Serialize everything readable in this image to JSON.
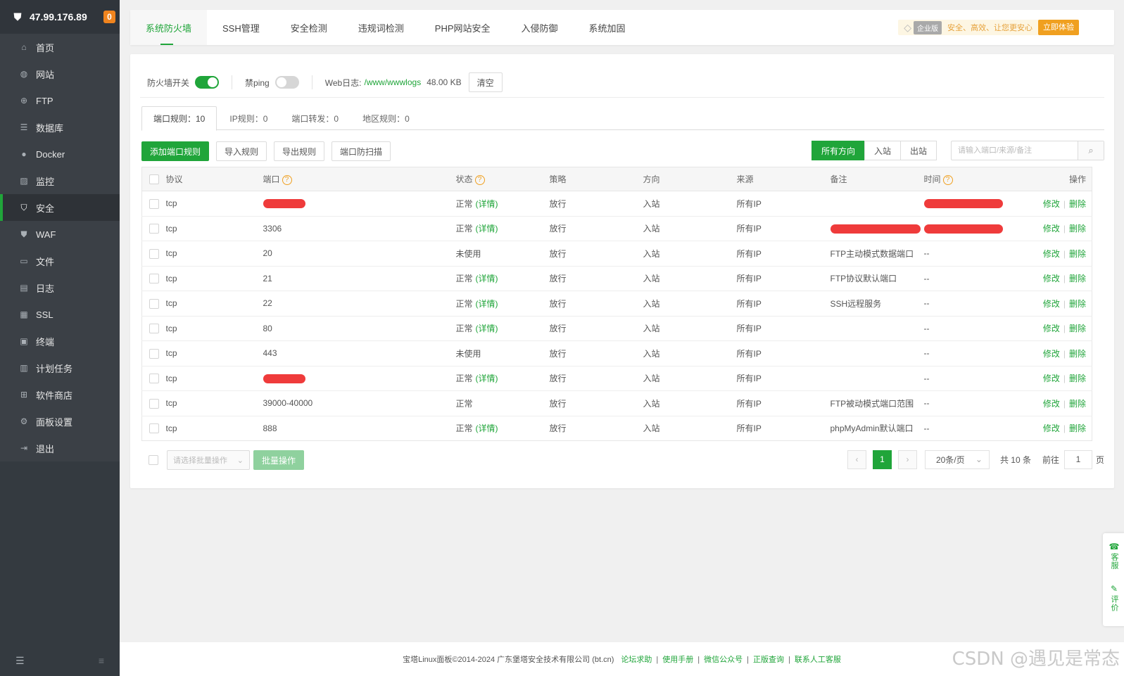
{
  "sidebar": {
    "ip": "47.99.176.89",
    "badge": "0",
    "items": [
      {
        "label": "首页",
        "icon": "home-icon",
        "glyph": "⌂"
      },
      {
        "label": "网站",
        "icon": "globe-icon",
        "glyph": "◍"
      },
      {
        "label": "FTP",
        "icon": "ftp-icon",
        "glyph": "⊕"
      },
      {
        "label": "数据库",
        "icon": "database-icon",
        "glyph": "☰"
      },
      {
        "label": "Docker",
        "icon": "docker-icon",
        "glyph": "●"
      },
      {
        "label": "监控",
        "icon": "monitor-icon",
        "glyph": "▨"
      },
      {
        "label": "安全",
        "icon": "shield-icon",
        "glyph": "⛉"
      },
      {
        "label": "WAF",
        "icon": "waf-icon",
        "glyph": "⛊"
      },
      {
        "label": "文件",
        "icon": "folder-icon",
        "glyph": "▭"
      },
      {
        "label": "日志",
        "icon": "log-icon",
        "glyph": "▤"
      },
      {
        "label": "SSL",
        "icon": "ssl-icon",
        "glyph": "▦"
      },
      {
        "label": "终端",
        "icon": "terminal-icon",
        "glyph": "▣"
      },
      {
        "label": "计划任务",
        "icon": "calendar-icon",
        "glyph": "▥"
      },
      {
        "label": "软件商店",
        "icon": "apps-icon",
        "glyph": "⊞"
      },
      {
        "label": "面板设置",
        "icon": "gear-icon",
        "glyph": "⚙"
      },
      {
        "label": "退出",
        "icon": "logout-icon",
        "glyph": "⇥"
      }
    ],
    "active_index": 6
  },
  "topbar": {
    "tabs": [
      "系统防火墙",
      "SSH管理",
      "安全检测",
      "违规词检测",
      "PHP网站安全",
      "入侵防御",
      "系统加固"
    ],
    "active_index": 0,
    "ent_tag": "企业版",
    "ent_slogan": "安全、高效、让您更安心",
    "ent_button": "立即体验"
  },
  "status": {
    "firewall_label": "防火墙开关",
    "firewall_on": true,
    "ping_label": "禁ping",
    "ping_on": false,
    "weblog_label": "Web日志:",
    "weblog_path": "/www/wwwlogs",
    "weblog_size": "48.00 KB",
    "clear_label": "清空"
  },
  "rule_tabs": [
    "端口规则：10",
    "IP规则：0",
    "端口转发：0",
    "地区规则：0"
  ],
  "toolbar": {
    "add_label": "添加端口规则",
    "import_label": "导入规则",
    "export_label": "导出规则",
    "scan_label": "端口防扫描",
    "directions": [
      "所有方向",
      "入站",
      "出站"
    ],
    "search_placeholder": "请输入端口/来源/备注"
  },
  "table": {
    "headers": {
      "protocol": "协议",
      "port": "端口",
      "status": "状态",
      "policy": "策略",
      "direction": "方向",
      "source": "来源",
      "remark": "备注",
      "time": "时间",
      "ops": "操作"
    },
    "edit_label": "修改",
    "delete_label": "删除",
    "detail_label": "(详情)",
    "rows": [
      {
        "protocol": "tcp",
        "port": "",
        "port_redacted": true,
        "status": "正常",
        "detail": true,
        "policy": "放行",
        "direction": "入站",
        "source": "所有IP",
        "remark": "",
        "time": "",
        "time_redacted": true
      },
      {
        "protocol": "tcp",
        "port": "3306",
        "status": "正常",
        "detail": true,
        "policy": "放行",
        "direction": "入站",
        "source": "所有IP",
        "remark": "",
        "remark_redacted": true,
        "time": ""
      },
      {
        "protocol": "tcp",
        "port": "20",
        "status": "未使用",
        "detail": false,
        "policy": "放行",
        "direction": "入站",
        "source": "所有IP",
        "remark": "FTP主动模式数据端口",
        "time": "--"
      },
      {
        "protocol": "tcp",
        "port": "21",
        "status": "正常",
        "detail": true,
        "policy": "放行",
        "direction": "入站",
        "source": "所有IP",
        "remark": "FTP协议默认端口",
        "time": "--"
      },
      {
        "protocol": "tcp",
        "port": "22",
        "status": "正常",
        "detail": true,
        "policy": "放行",
        "direction": "入站",
        "source": "所有IP",
        "remark": "SSH远程服务",
        "time": "--"
      },
      {
        "protocol": "tcp",
        "port": "80",
        "status": "正常",
        "detail": true,
        "policy": "放行",
        "direction": "入站",
        "source": "所有IP",
        "remark": "",
        "time": "--"
      },
      {
        "protocol": "tcp",
        "port": "443",
        "status": "未使用",
        "detail": false,
        "policy": "放行",
        "direction": "入站",
        "source": "所有IP",
        "remark": "",
        "time": "--"
      },
      {
        "protocol": "tcp",
        "port": "",
        "port_redacted": true,
        "status": "正常",
        "detail": true,
        "policy": "放行",
        "direction": "入站",
        "source": "所有IP",
        "remark": "",
        "time": "--"
      },
      {
        "protocol": "tcp",
        "port": "39000-40000",
        "status": "正常",
        "detail": false,
        "policy": "放行",
        "direction": "入站",
        "source": "所有IP",
        "remark": "FTP被动模式端口范围",
        "time": "--"
      },
      {
        "protocol": "tcp",
        "port": "888",
        "status": "正常",
        "detail": true,
        "policy": "放行",
        "direction": "入站",
        "source": "所有IP",
        "remark": "phpMyAdmin默认端口",
        "time": "--"
      }
    ]
  },
  "pager": {
    "batch_placeholder": "请选择批量操作",
    "batch_button": "批量操作",
    "current_page": "1",
    "page_size": "20条/页",
    "total": "共 10 条",
    "goto_label": "前往",
    "goto_value": "1",
    "page_unit": "页"
  },
  "footer": {
    "copyright": "宝塔Linux面板©2014-2024 广东堡塔安全技术有限公司 (bt.cn)",
    "links": [
      "论坛求助",
      "使用手册",
      "微信公众号",
      "正版查询",
      "联系人工客服"
    ]
  },
  "float": {
    "service": "客服",
    "feedback": "评价"
  },
  "watermark": "CSDN @遇见是常态",
  "colors": {
    "accent": "#20a53a",
    "sidebar": "#343a40",
    "warning": "#f0a020",
    "redact": "#ef3b3b"
  }
}
